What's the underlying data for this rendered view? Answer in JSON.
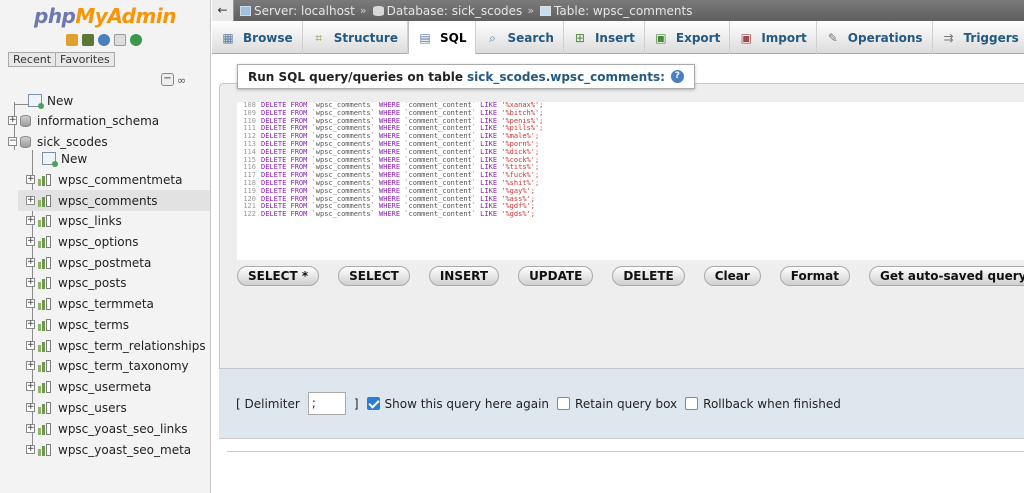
{
  "logo": {
    "part1": "php",
    "part2": "MyAdmin"
  },
  "nav": {
    "recent_label": "Recent",
    "favorites_label": "Favorites",
    "new_label": "New",
    "databases": [
      {
        "name": "information_schema"
      },
      {
        "name": "sick_scodes"
      }
    ],
    "db_new_label": "New",
    "tables": [
      "wpsc_commentmeta",
      "wpsc_comments",
      "wpsc_links",
      "wpsc_options",
      "wpsc_postmeta",
      "wpsc_posts",
      "wpsc_termmeta",
      "wpsc_terms",
      "wpsc_term_relationships",
      "wpsc_term_taxonomy",
      "wpsc_usermeta",
      "wpsc_users",
      "wpsc_yoast_seo_links",
      "wpsc_yoast_seo_meta"
    ],
    "selected_table": "wpsc_comments"
  },
  "breadcrumb": {
    "server": "Server: localhost",
    "database": "Database: sick_scodes",
    "table": "Table: wpsc_comments"
  },
  "tabs": [
    {
      "label": "Browse",
      "icon": "browse-icon"
    },
    {
      "label": "Structure",
      "icon": "structure-icon"
    },
    {
      "label": "SQL",
      "icon": "sql-icon",
      "active": true
    },
    {
      "label": "Search",
      "icon": "search-icon"
    },
    {
      "label": "Insert",
      "icon": "insert-icon"
    },
    {
      "label": "Export",
      "icon": "export-icon"
    },
    {
      "label": "Import",
      "icon": "import-icon"
    },
    {
      "label": "Operations",
      "icon": "operations-icon"
    },
    {
      "label": "Triggers",
      "icon": "triggers-icon"
    }
  ],
  "sql_panel": {
    "heading": "Run SQL query/queries on table",
    "table_name": "sick_scodes.wpsc_comments:",
    "query_lines": [
      {
        "num": "108",
        "pattern": "'%xanax%';"
      },
      {
        "num": "109",
        "pattern": "'%bitch%';"
      },
      {
        "num": "110",
        "pattern": "'%penis%';"
      },
      {
        "num": "111",
        "pattern": "'%pills%';"
      },
      {
        "num": "112",
        "pattern": "'%male%';"
      },
      {
        "num": "113",
        "pattern": "'%porn%';"
      },
      {
        "num": "114",
        "pattern": "'%dick%';"
      },
      {
        "num": "115",
        "pattern": "'%cock%';"
      },
      {
        "num": "116",
        "pattern": "'%tits%';"
      },
      {
        "num": "117",
        "pattern": "'%fuck%';"
      },
      {
        "num": "118",
        "pattern": "'%shit%';"
      },
      {
        "num": "119",
        "pattern": "'%gay%';"
      },
      {
        "num": "120",
        "pattern": "'%ass%';"
      },
      {
        "num": "121",
        "pattern": "'%gdf%';"
      },
      {
        "num": "122",
        "pattern": "'%gds%';"
      }
    ],
    "query_prefix": {
      "delete_kw": "DELETE FROM",
      "table": "`wpsc_comments`",
      "where_kw": "WHERE",
      "column": "`comment_content`",
      "like_kw": "LIKE"
    },
    "buttons": [
      "SELECT *",
      "SELECT",
      "INSERT",
      "UPDATE",
      "DELETE",
      "Clear",
      "Format",
      "Get auto-saved query"
    ]
  },
  "options": {
    "delimiter_label_open": "[ Delimiter",
    "delimiter_value": ";",
    "delimiter_label_close": "]",
    "show_query_label": "Show this query here again",
    "show_query_checked": true,
    "retain_label": "Retain query box",
    "retain_checked": false,
    "rollback_label": "Rollback when finished",
    "rollback_checked": false
  },
  "colors": {
    "link": "#235a81",
    "logo_php": "#6c78af",
    "logo_myadmin": "#f89406",
    "sql_keyword": "#8a1fb0",
    "sql_string": "#cc3333"
  }
}
